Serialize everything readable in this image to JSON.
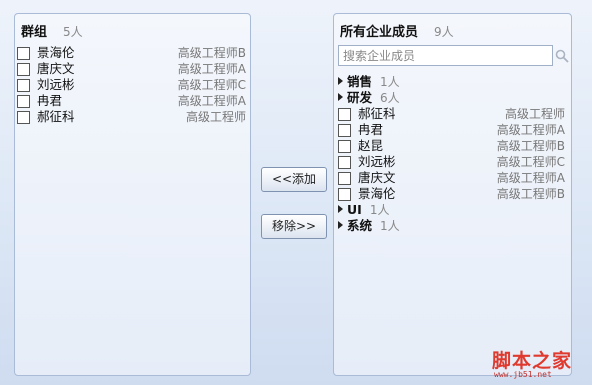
{
  "left_panel": {
    "title": "群组",
    "count": "5人",
    "members": [
      {
        "name": "景海伦",
        "role": "高级工程师B"
      },
      {
        "name": "唐庆文",
        "role": "高级工程师A"
      },
      {
        "name": "刘远彬",
        "role": "高级工程师C"
      },
      {
        "name": "冉君",
        "role": "高级工程师A"
      },
      {
        "name": "郝征科",
        "role": "高级工程师"
      }
    ]
  },
  "right_panel": {
    "title": "所有企业成员",
    "count": "9人",
    "search_placeholder": "搜索企业成员",
    "groups": [
      {
        "name": "销售",
        "count": "1人",
        "members": []
      },
      {
        "name": "研发",
        "count": "6人",
        "members": [
          {
            "name": "郝征科",
            "role": "高级工程师"
          },
          {
            "name": "冉君",
            "role": "高级工程师A"
          },
          {
            "name": "赵昆",
            "role": "高级工程师B"
          },
          {
            "name": "刘远彬",
            "role": "高级工程师C"
          },
          {
            "name": "唐庆文",
            "role": "高级工程师A"
          },
          {
            "name": "景海伦",
            "role": "高级工程师B"
          }
        ]
      },
      {
        "name": "UI",
        "count": "1人",
        "members": []
      },
      {
        "name": "系统",
        "count": "1人",
        "members": []
      }
    ]
  },
  "buttons": {
    "add_label": "<<添加",
    "remove_label": "移除>>"
  },
  "watermark": {
    "text": "脚本之家",
    "url": "www.jb51.net"
  }
}
